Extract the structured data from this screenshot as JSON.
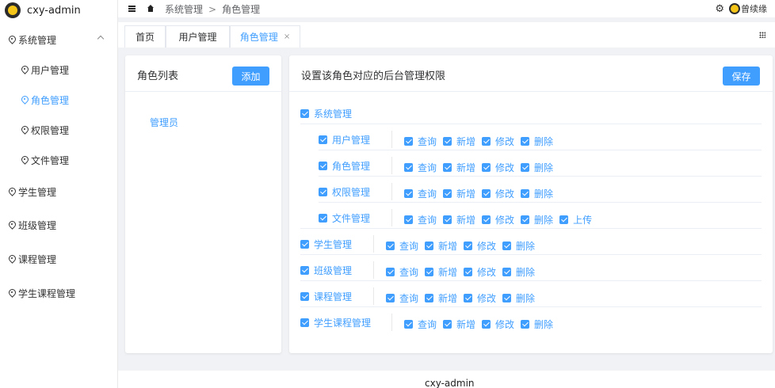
{
  "app": {
    "title": "cxy-admin"
  },
  "sidebar": {
    "groups": [
      {
        "label": "系统管理",
        "items": [
          {
            "label": "用户管理"
          },
          {
            "label": "角色管理"
          },
          {
            "label": "权限管理"
          },
          {
            "label": "文件管理"
          }
        ]
      },
      {
        "label": "学生管理"
      },
      {
        "label": "班级管理"
      },
      {
        "label": "课程管理"
      },
      {
        "label": "学生课程管理"
      }
    ]
  },
  "header": {
    "breadcrumb": [
      "系统管理",
      "角色管理"
    ],
    "separator": ">",
    "username": "曾续缘"
  },
  "tabs": [
    {
      "label": "首页"
    },
    {
      "label": "用户管理"
    },
    {
      "label": "角色管理",
      "close": "×"
    }
  ],
  "role_list": {
    "title": "角色列表",
    "add_label": "添加",
    "roles": [
      "管理员"
    ]
  },
  "permissions": {
    "title": "设置该角色对应的后台管理权限",
    "save_label": "保存",
    "root": "系统管理",
    "modules": [
      {
        "label": "用户管理",
        "ops": [
          "查询",
          "新增",
          "修改",
          "删除"
        ]
      },
      {
        "label": "角色管理",
        "ops": [
          "查询",
          "新增",
          "修改",
          "删除"
        ]
      },
      {
        "label": "权限管理",
        "ops": [
          "查询",
          "新增",
          "修改",
          "删除"
        ]
      },
      {
        "label": "文件管理",
        "ops": [
          "查询",
          "新增",
          "修改",
          "删除",
          "上传"
        ]
      },
      {
        "label": "学生管理",
        "ops": [
          "查询",
          "新增",
          "修改",
          "删除"
        ]
      },
      {
        "label": "班级管理",
        "ops": [
          "查询",
          "新增",
          "修改",
          "删除"
        ]
      },
      {
        "label": "课程管理",
        "ops": [
          "查询",
          "新增",
          "修改",
          "删除"
        ]
      },
      {
        "label": "学生课程管理",
        "ops": [
          "查询",
          "新增",
          "修改",
          "删除"
        ]
      }
    ]
  },
  "footer": {
    "text": "cxy-admin"
  },
  "colors": {
    "accent": "#409eff"
  }
}
